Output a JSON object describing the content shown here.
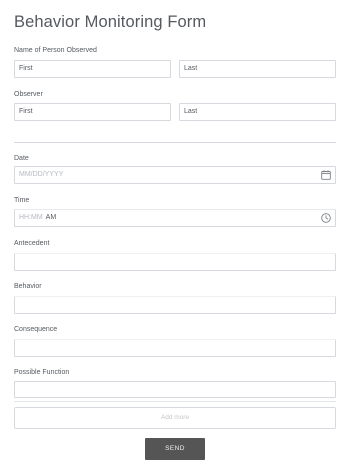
{
  "form": {
    "title": "Behavior Monitoring Form"
  },
  "fields": {
    "person_observed": {
      "label": "Name of Person Observed",
      "first_placeholder": "First",
      "last_placeholder": "Last"
    },
    "observer": {
      "label": "Observer",
      "first_placeholder": "First",
      "last_placeholder": "Last"
    },
    "date": {
      "label": "Date",
      "placeholder": "MM/DD/YYYY",
      "icon": "calendar-icon"
    },
    "time": {
      "label": "Time",
      "placeholder_time": "HH:MM",
      "ampm": "AM",
      "icon": "clock-icon"
    },
    "antecedent": {
      "label": "Antecedent",
      "value": ""
    },
    "behavior": {
      "label": "Behavior",
      "value": ""
    },
    "consequence": {
      "label": "Consequence",
      "value": ""
    },
    "possible_function": {
      "label": "Possible Function",
      "value": ""
    }
  },
  "actions": {
    "add_more_label": "Add more",
    "send_label": "SEND"
  },
  "colors": {
    "border": "#d6dadf",
    "text": "#555a60",
    "placeholder": "#b4b9bf",
    "button": "#555555"
  }
}
